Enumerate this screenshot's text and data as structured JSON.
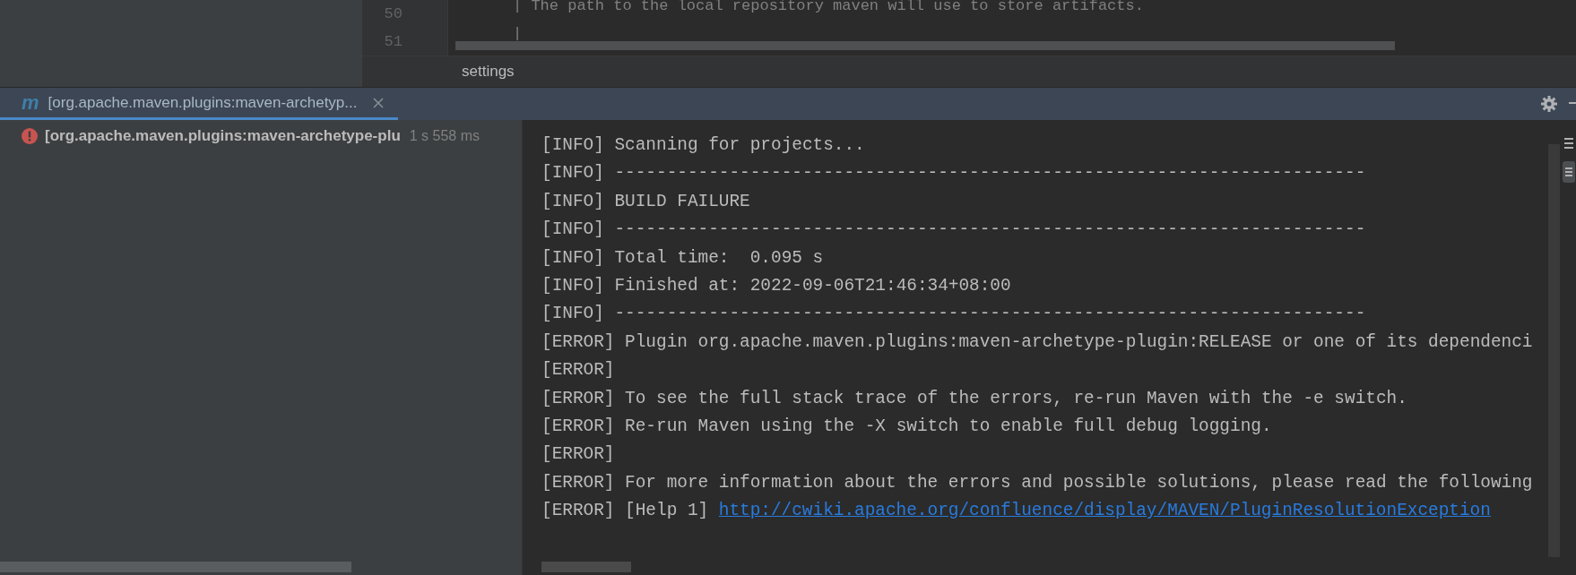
{
  "editor": {
    "lines": [
      {
        "number": "50",
        "text": "| The path to the local repository maven will use to store artifacts."
      },
      {
        "number": "51",
        "text": "|"
      }
    ],
    "breadcrumb": "settings"
  },
  "run_tab": {
    "icon": "m",
    "label": "[org.apache.maven.plugins:maven-archetyp...",
    "selected": true
  },
  "tree": [
    {
      "kind": "error",
      "label": "[org.apache.maven.plugins:maven-archetype-plu",
      "duration": "1 s 558 ms"
    }
  ],
  "console": [
    {
      "kind": "plain",
      "text": "[INFO] Scanning for projects..."
    },
    {
      "kind": "plain",
      "text": "[INFO] ------------------------------------------------------------------------"
    },
    {
      "kind": "plain",
      "text": "[INFO] BUILD FAILURE"
    },
    {
      "kind": "plain",
      "text": "[INFO] ------------------------------------------------------------------------"
    },
    {
      "kind": "plain",
      "text": "[INFO] Total time:  0.095 s"
    },
    {
      "kind": "plain",
      "text": "[INFO] Finished at: 2022-09-06T21:46:34+08:00"
    },
    {
      "kind": "plain",
      "text": "[INFO] ------------------------------------------------------------------------"
    },
    {
      "kind": "plain",
      "text": "[ERROR] Plugin org.apache.maven.plugins:maven-archetype-plugin:RELEASE or one of its dependenci"
    },
    {
      "kind": "plain",
      "text": "[ERROR]"
    },
    {
      "kind": "plain",
      "text": "[ERROR] To see the full stack trace of the errors, re-run Maven with the -e switch."
    },
    {
      "kind": "plain",
      "text": "[ERROR] Re-run Maven using the -X switch to enable full debug logging."
    },
    {
      "kind": "plain",
      "text": "[ERROR]"
    },
    {
      "kind": "plain",
      "text": "[ERROR] For more information about the errors and possible solutions, please read the following"
    },
    {
      "kind": "link",
      "text": "[ERROR] [Help 1]",
      "link": "http://cwiki.apache.org/confluence/display/MAVEN/PluginResolutionException"
    }
  ]
}
